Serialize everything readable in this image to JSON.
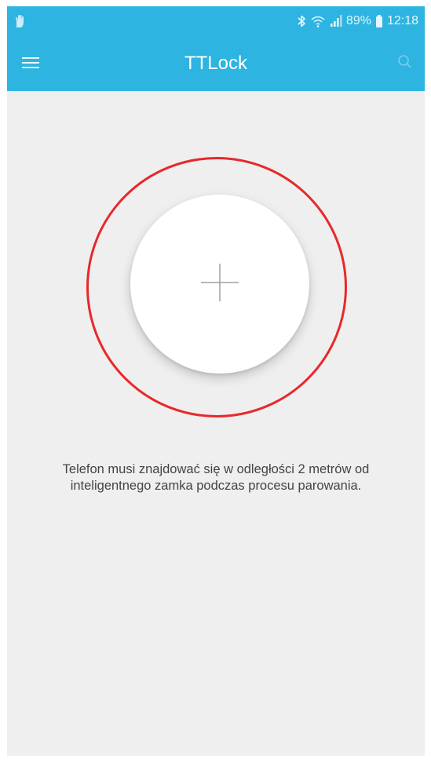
{
  "status_bar": {
    "battery": "89%",
    "time": "12:18"
  },
  "app_bar": {
    "title": "TTLock"
  },
  "main": {
    "hint_text": "Telefon musi znajdować się w odległości 2 metrów od inteligentnego zamka podczas procesu parowania."
  },
  "colors": {
    "accent": "#2db4e0",
    "highlight_ring": "#e8282b",
    "background": "#efefef"
  },
  "icons": {
    "menu": "hamburger-menu-icon",
    "search": "search-icon",
    "add": "plus-icon",
    "bluetooth": "bluetooth-icon",
    "wifi": "wifi-icon",
    "signal": "signal-icon",
    "battery": "battery-icon"
  }
}
